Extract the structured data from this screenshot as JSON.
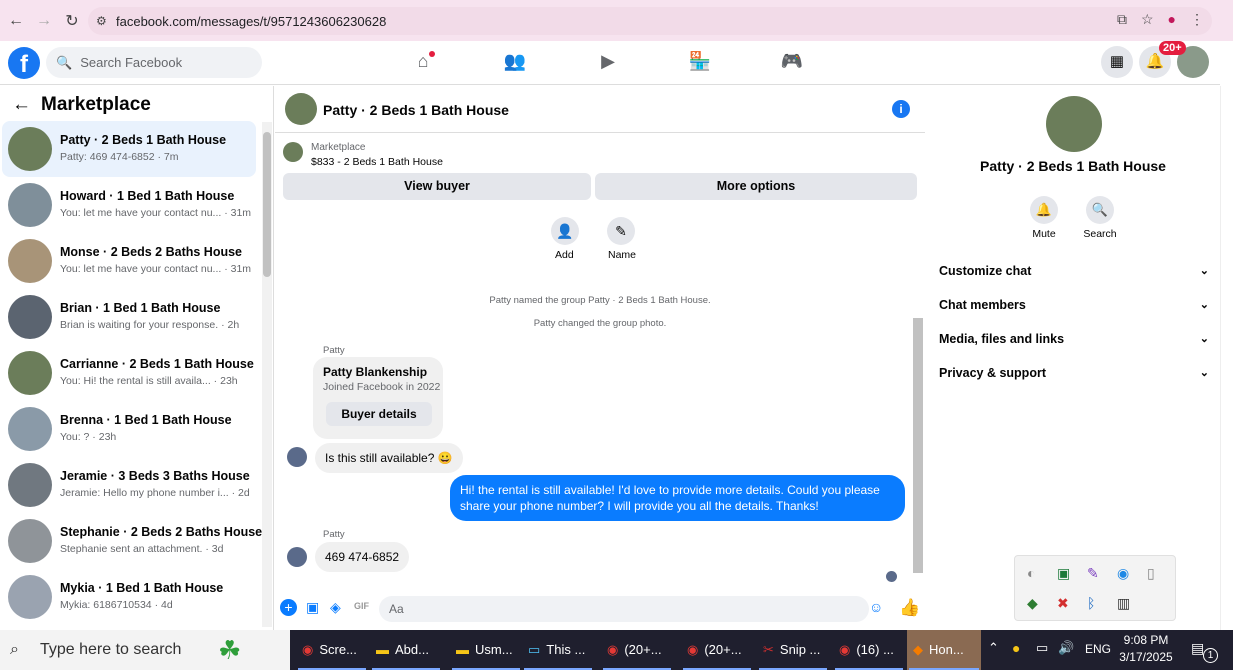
{
  "browser": {
    "url": "facebook.com/messages/t/9571243606230628",
    "colors": {
      "tab_bar": "#f7e3ef"
    }
  },
  "facebook": {
    "search_placeholder": "Search Facebook",
    "notification_badge": "20+",
    "brand_color": "#1877f2"
  },
  "sidebar": {
    "title": "Marketplace",
    "conversations": [
      {
        "title": "Patty · 2 Beds 1 Bath House",
        "snippet": "Patty: 469 474-6852 · 7m",
        "selected": true
      },
      {
        "title": "Howard · 1 Bed 1 Bath House",
        "snippet": "You: let me have your contact nu... · 31m"
      },
      {
        "title": "Monse · 2 Beds 2 Baths House",
        "snippet": "You: let me have your contact nu... · 31m"
      },
      {
        "title": "Brian · 1 Bed 1 Bath House",
        "snippet": "Brian is waiting for your response. · 2h"
      },
      {
        "title": "Carrianne · 2 Beds 1 Bath House",
        "snippet": "You: Hi! the rental is still availa... · 23h"
      },
      {
        "title": "Brenna · 1 Bed 1 Bath House",
        "snippet": "You: ? · 23h"
      },
      {
        "title": "Jeramie · 3 Beds 3 Baths House",
        "snippet": "Jeramie: Hello my phone number i... · 2d"
      },
      {
        "title": "Stephanie · 2 Beds 2 Baths House",
        "snippet": "Stephanie sent an attachment. · 3d"
      },
      {
        "title": "Mykia · 1 Bed 1 Bath House",
        "snippet": "Mykia: 6186710534 · 4d"
      }
    ]
  },
  "chat": {
    "title": "Patty · 2 Beds 1 Bath House",
    "marketplace_label": "Marketplace",
    "listing": "$833 - 2 Beds 1 Bath House",
    "view_buyer": "View buyer",
    "more_options": "More options",
    "add_label": "Add",
    "name_label": "Name",
    "system1": "Patty named the group Patty · 2 Beds 1 Bath House.",
    "system2": "Patty changed the group photo.",
    "sender1": "Patty",
    "card_name": "Patty Blankenship",
    "card_joined": "Joined Facebook in 2022",
    "buyer_details": "Buyer details",
    "msg1": "Is this still available? 😀",
    "out_msg": "Hi! the rental is still available! I'd love to provide more details. Could you please share your phone number? I will provide you all the details. Thanks!",
    "sender2": "Patty",
    "msg2": "469 474-6852",
    "composer_placeholder": "Aa",
    "out_color": "#0a7cff"
  },
  "details": {
    "name": "Patty · 2 Beds 1 Bath House",
    "mute": "Mute",
    "search": "Search",
    "sections": [
      "Customize chat",
      "Chat members",
      "Media, files and links",
      "Privacy & support"
    ]
  },
  "taskbar": {
    "search_placeholder": "Type here to search",
    "items": [
      "Scre...",
      "Abd...",
      "Usm...",
      "This ...",
      "(20+...",
      "(20+...",
      "Snip ...",
      "(16) ...",
      "Hon..."
    ],
    "lang": "ENG",
    "time": "9:08 PM",
    "date": "3/17/2025",
    "notif_count": "1"
  }
}
